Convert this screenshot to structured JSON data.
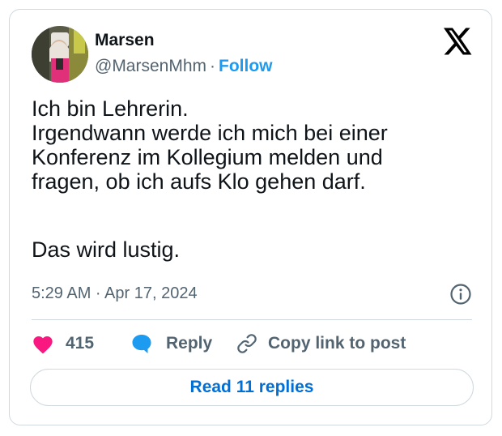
{
  "author": {
    "name": "Marsen",
    "handle": "@MarsenMhm",
    "separator": "·",
    "follow_label": "Follow"
  },
  "tweet": {
    "lines": [
      "Ich bin Lehrerin.",
      "Irgendwann werde ich mich bei einer",
      "Konferenz im Kollegium melden und",
      "fragen, ob ich aufs Klo gehen darf.",
      "Das wird lustig."
    ],
    "timestamp": "5:29 AM · Apr 17, 2024"
  },
  "actions": {
    "likes": "415",
    "reply_label": "Reply",
    "copy_label": "Copy link to post"
  },
  "read_replies_label": "Read 11 replies",
  "icons": {
    "logo": "x-logo-icon",
    "info": "info-icon",
    "like": "heart-icon",
    "reply": "speech-bubble-icon",
    "copy": "link-icon"
  },
  "colors": {
    "text": "#0f1419",
    "secondary": "#536471",
    "follow": "#1d9bf0",
    "heart": "#f91880",
    "reply_bubble": "#1d9bf0",
    "read_replies": "#006fd6",
    "border": "#cfd9de"
  }
}
